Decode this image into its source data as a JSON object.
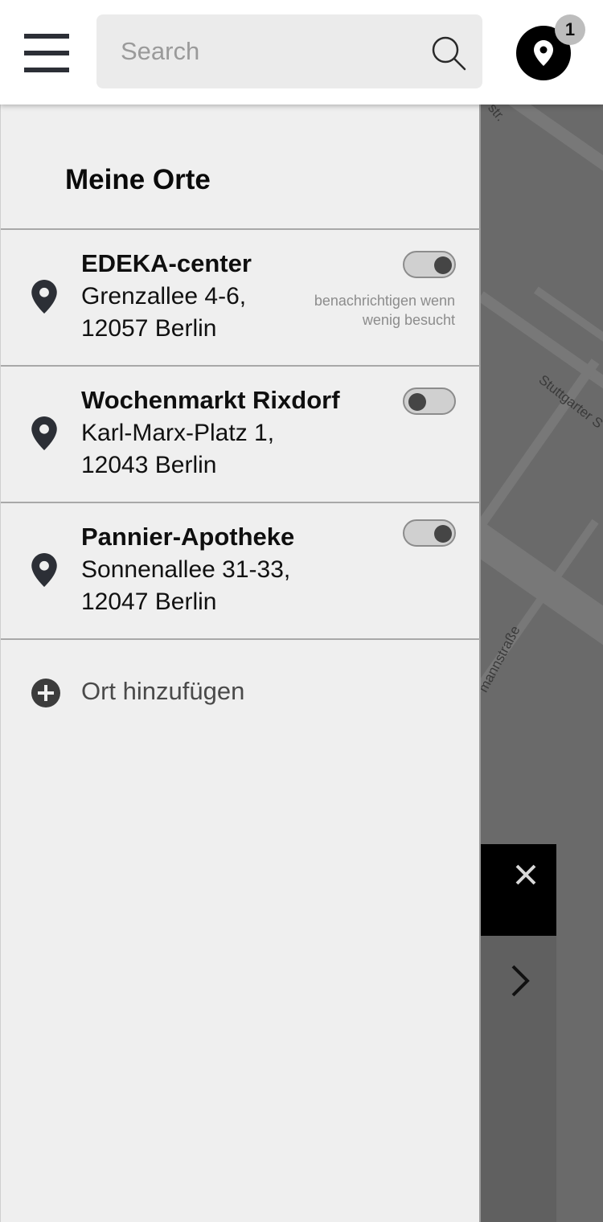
{
  "header": {
    "search_placeholder": "Search",
    "location_badge_count": "1"
  },
  "map": {
    "street_labels": [
      "str.",
      "Stuttgarter S",
      "mannstraße"
    ]
  },
  "drawer": {
    "title": "Meine Orte",
    "places": [
      {
        "name": "EDEKA-center",
        "street": "Grenzallee 4-6,",
        "city": "12057 Berlin",
        "notify_enabled": true,
        "notify_text": "benachrichtigen wenn wenig besucht"
      },
      {
        "name": "Wochenmarkt Rixdorf",
        "street": "Karl-Marx-Platz 1,",
        "city": "12043 Berlin",
        "notify_enabled": false
      },
      {
        "name": "Pannier-Apotheke",
        "street": "Sonnenallee 31-33,",
        "city": "12047 Berlin",
        "notify_enabled": true
      }
    ],
    "add_place_label": "Ort hinzufügen"
  },
  "icons": {
    "menu": "menu-icon",
    "search": "search-icon",
    "location": "location-pin-icon",
    "add": "plus-circle-icon",
    "close": "close-icon",
    "next": "chevron-right-icon"
  },
  "colors": {
    "drawer_bg": "#efefef",
    "header_bg": "#ffffff",
    "map_bg": "#6a6a6a",
    "accent_black": "#000000",
    "toggle_knob": "#454545"
  }
}
